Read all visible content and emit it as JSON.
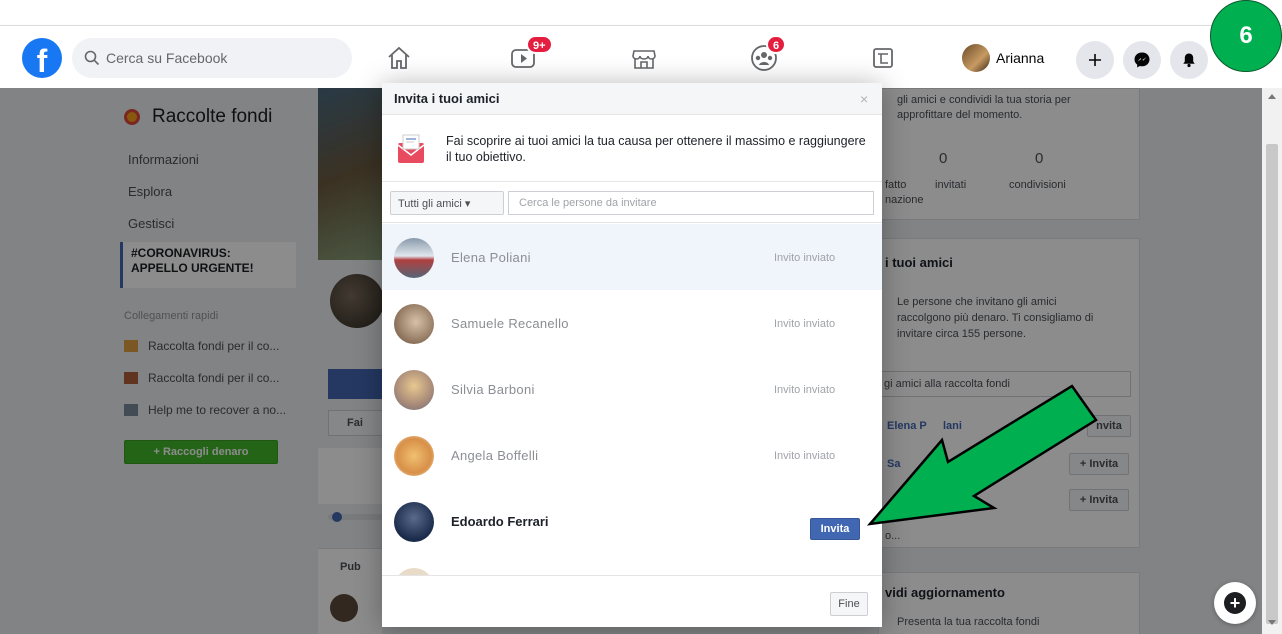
{
  "navbar": {
    "logo_letter": "f",
    "search_placeholder": "Cerca su Facebook",
    "watch_badge": "9+",
    "groups_badge": "6",
    "profile_name": "Arianna",
    "step_number": "6"
  },
  "icons": [
    "search-icon",
    "home-icon",
    "watch-icon",
    "marketplace-icon",
    "groups-icon",
    "gaming-icon",
    "plus-icon",
    "messenger-icon",
    "bell-icon",
    "envelope-icon",
    "close-icon"
  ],
  "sidebar": {
    "title": "Raccolte fondi",
    "links": [
      "Informazioni",
      "Esplora",
      "Gestisci"
    ],
    "active_line1": "#CORONAVIRUS:",
    "active_line2": "APPELLO URGENTE!",
    "quick_title": "Collegamenti rapidi",
    "quick_links": [
      "Raccolta fondi per il co...",
      "Raccolta fondi per il co...",
      "Help me to recover a no..."
    ],
    "raise_button": "+ Raccogli denaro"
  },
  "center": {
    "fai_label": "Fai",
    "pub_label": "Pub"
  },
  "right": {
    "top_text_1": "gli amici e condividi la tua storia per",
    "top_text_2": "approfittare del momento.",
    "stat_invited_value": "0",
    "stat_shares_value": "0",
    "stat_fatto": "fatto",
    "stat_nazione": "nazione",
    "stat_invited_label": "invitati",
    "stat_shares_label": "condivisioni",
    "invite_title": "i tuoi amici",
    "invite_text_1": "Le persone che invitano gli amici",
    "invite_text_2": "raccolgono più denaro. Ti consigliamo di",
    "invite_text_3": "invitare circa 155 persone.",
    "add_input_text": "gi amici alla raccolta fondi",
    "suggest_1": "Elena P",
    "suggest_1b": "lani",
    "suggest_2": "Sa",
    "invita_label": "+ Invita",
    "invita_partial": "nvita",
    "ellipsis": "o...",
    "update_title": "vidi aggiornamento",
    "update_text": "Presenta la tua raccolta fondi"
  },
  "modal": {
    "title": "Invita i tuoi amici",
    "close": "×",
    "info_text": "Fai scoprire ai tuoi amici la tua causa per ottenere il massimo e raggiungere il tuo obiettivo.",
    "filter_label": "Tutti gli amici ▾",
    "filter_placeholder": "Cerca le persone da invitare",
    "friends": [
      {
        "name": "Elena Poliani",
        "status": "Invito inviato"
      },
      {
        "name": "Samuele Recanello",
        "status": "Invito inviato"
      },
      {
        "name": "Silvia Barboni",
        "status": "Invito inviato"
      },
      {
        "name": "Angela Boffelli",
        "status": "Invito inviato"
      },
      {
        "name": "Edoardo Ferrari",
        "button": "Invita"
      }
    ],
    "done_button": "Fine"
  },
  "colors": {
    "facebook_blue": "#1877f2",
    "button_blue": "#4267b2",
    "badge_red": "#e41e3f",
    "annotation_green": "#00b050"
  }
}
